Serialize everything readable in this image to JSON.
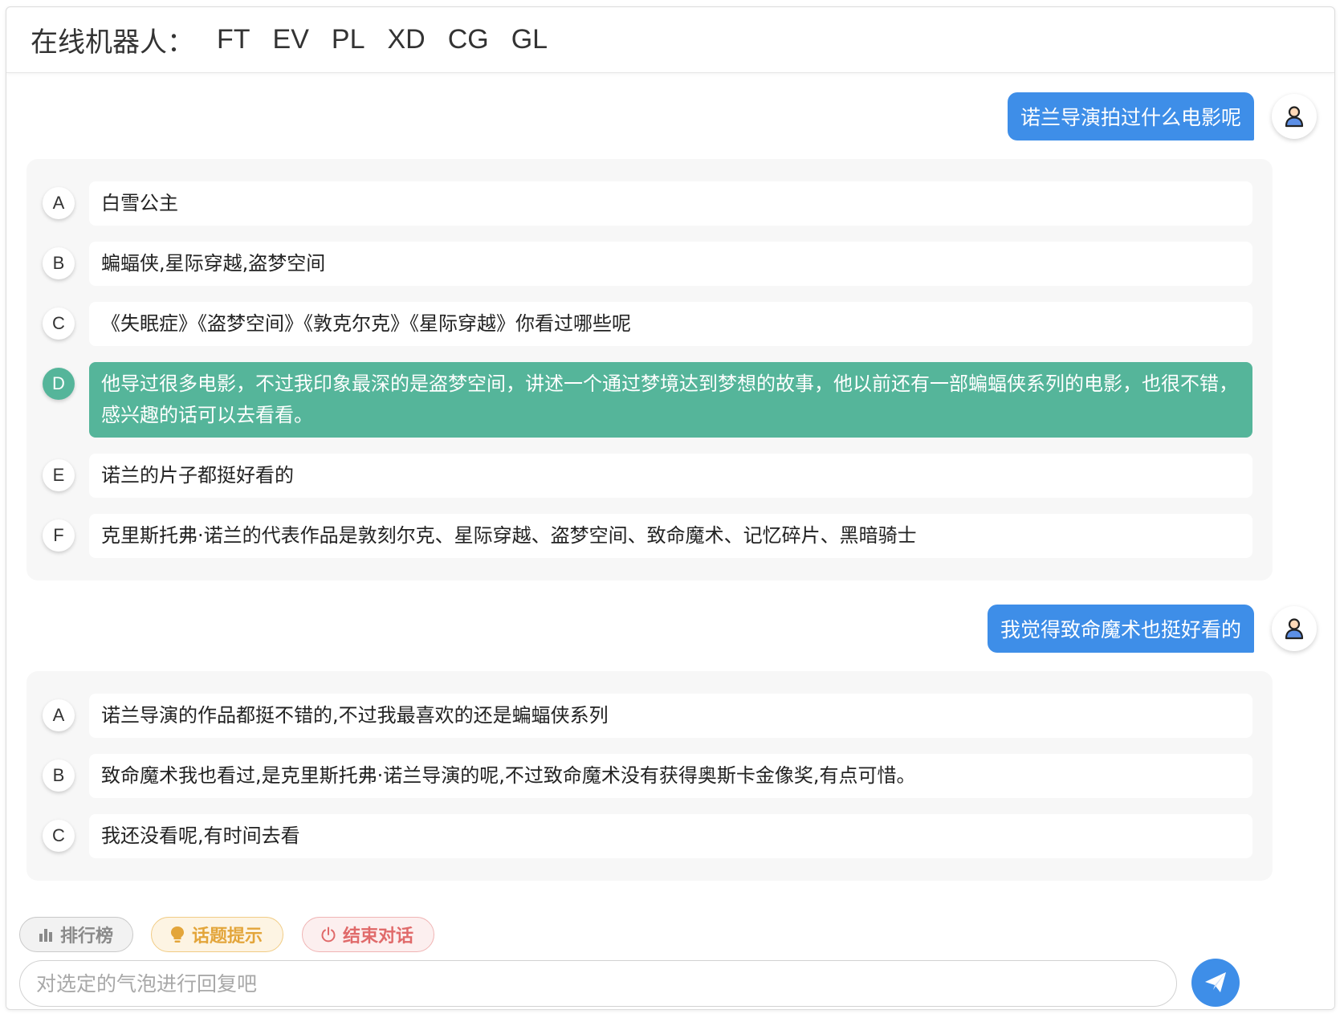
{
  "header": {
    "title": "在线机器人：",
    "bots": [
      "FT",
      "EV",
      "PL",
      "XD",
      "CG",
      "GL"
    ]
  },
  "conversation": [
    {
      "user_message": "诺兰导演拍过什么电影呢",
      "options": [
        {
          "letter": "A",
          "text": "白雪公主"
        },
        {
          "letter": "B",
          "text": "蝙蝠侠,星际穿越,盗梦空间"
        },
        {
          "letter": "C",
          "text": "《失眠症》《盗梦空间》《敦克尔克》《星际穿越》你看过哪些呢"
        },
        {
          "letter": "D",
          "text": "他导过很多电影，不过我印象最深的是盗梦空间，讲述一个通过梦境达到梦想的故事，他以前还有一部蝙蝠侠系列的电影，也很不错，感兴趣的话可以去看看。",
          "selected": true
        },
        {
          "letter": "E",
          "text": "诺兰的片子都挺好看的"
        },
        {
          "letter": "F",
          "text": "克里斯托弗·诺兰的代表作品是敦刻尔克、星际穿越、盗梦空间、致命魔术、记忆碎片、黑暗骑士"
        }
      ]
    },
    {
      "user_message": "我觉得致命魔术也挺好看的",
      "options": [
        {
          "letter": "A",
          "text": "诺兰导演的作品都挺不错的,不过我最喜欢的还是蝙蝠侠系列"
        },
        {
          "letter": "B",
          "text": "致命魔术我也看过,是克里斯托弗·诺兰导演的呢,不过致命魔术没有获得奥斯卡金像奖,有点可惜。"
        },
        {
          "letter": "C",
          "text": "我还没看呢,有时间去看"
        }
      ]
    }
  ],
  "toolbar": {
    "rank_label": "排行榜",
    "topic_label": "话题提示",
    "end_label": "结束对话"
  },
  "input": {
    "placeholder": "对选定的气泡进行回复吧",
    "value": ""
  },
  "colors": {
    "user_bubble": "#3e8ee8",
    "selected_option": "#55b59a",
    "send_button": "#3e8ee8"
  },
  "icons": {
    "avatar": "user-avatar-icon",
    "rank": "bar-chart-icon",
    "topic": "lightbulb-icon",
    "end": "power-icon",
    "send": "paper-plane-icon"
  }
}
